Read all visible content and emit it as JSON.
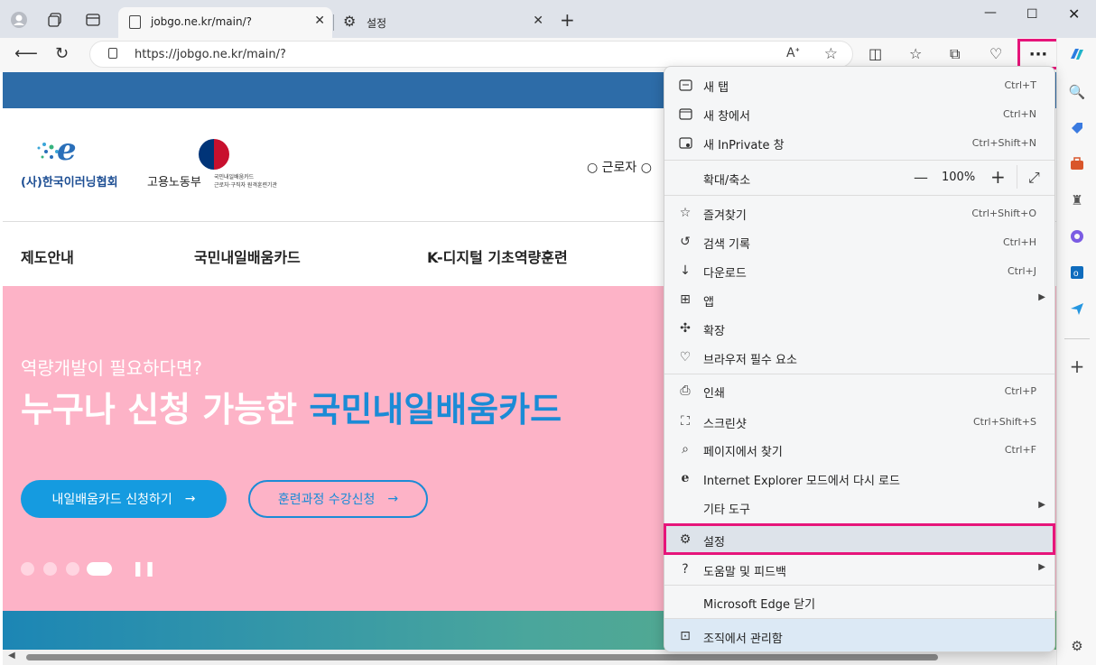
{
  "browser": {
    "tabs": [
      {
        "title": "jobgo.ne.kr/main/?"
      },
      {
        "title": "설정"
      }
    ],
    "address": "https://jobgo.ne.kr/main/?",
    "read_aloud": "A͡",
    "more_label": "···"
  },
  "site": {
    "org_name": "(사)한국이러닝협회",
    "ministry": "고용노동부",
    "ministry_sub1": "국민내일배움카드",
    "ministry_sub2": "근로자·구직자 원격훈련기관",
    "radio_label": "○ 근로자 ○",
    "gnb": [
      "제도안내",
      "국민내일배움카드",
      "K-디지털 기초역량훈련"
    ],
    "hero_sub": "역량개발이 필요하다면?",
    "hero_title_plain": "누구나 신청 가능한 ",
    "hero_title_highlight": "국민내일배움카드",
    "btn_apply": "내일배움카드 신청하기",
    "btn_course": "훈련과정 수강신청",
    "arrow": "→",
    "pause": "❚❚"
  },
  "menu": {
    "items": [
      {
        "label": "새 탭",
        "shortcut": "Ctrl+T"
      },
      {
        "label": "새 창에서",
        "shortcut": "Ctrl+N"
      },
      {
        "label": "새 InPrivate 창",
        "shortcut": "Ctrl+Shift+N"
      },
      {
        "label": "확대/축소",
        "zoom": "100%"
      },
      {
        "label": "즐겨찾기",
        "shortcut": "Ctrl+Shift+O"
      },
      {
        "label": "검색 기록",
        "shortcut": "Ctrl+H"
      },
      {
        "label": "다운로드",
        "shortcut": "Ctrl+J"
      },
      {
        "label": "앱",
        "shortcut": ""
      },
      {
        "label": "확장",
        "shortcut": ""
      },
      {
        "label": "브라우저 필수 요소",
        "shortcut": ""
      },
      {
        "label": "인쇄",
        "shortcut": "Ctrl+P"
      },
      {
        "label": "스크린샷",
        "shortcut": "Ctrl+Shift+S"
      },
      {
        "label": "페이지에서 찾기",
        "shortcut": "Ctrl+F"
      },
      {
        "label": "Internet Explorer 모드에서 다시 로드",
        "shortcut": ""
      },
      {
        "label": "기타 도구",
        "shortcut": ""
      },
      {
        "label": "설정",
        "shortcut": ""
      },
      {
        "label": "도움말 및 피드백",
        "shortcut": ""
      },
      {
        "label": "Microsoft Edge 닫기",
        "shortcut": ""
      },
      {
        "label": "조직에서 관리함",
        "shortcut": ""
      }
    ]
  },
  "colors": {
    "highlight": "#e6157a",
    "hero_bg": "#fdb3c7",
    "accent": "#1b8bd6"
  }
}
